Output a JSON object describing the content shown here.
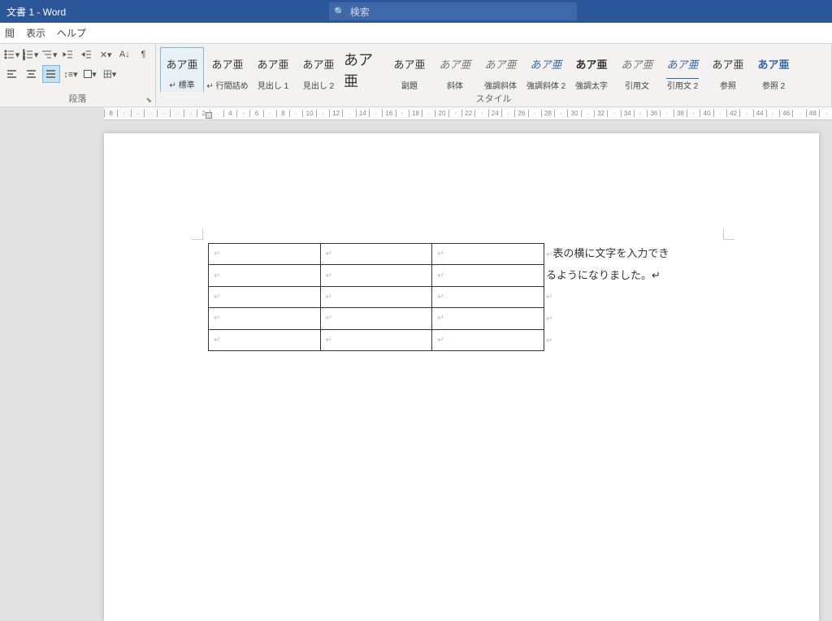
{
  "titlebar": {
    "title": "文書 1  -  Word",
    "search_placeholder": "検索"
  },
  "menubar": {
    "tabs": [
      "閲",
      "表示",
      "ヘルプ"
    ]
  },
  "ribbon": {
    "paragraph_label": "段落",
    "styles_label": "スタイル",
    "styles": [
      {
        "preview": "あア亜",
        "name": "↵ 標準",
        "cls": ""
      },
      {
        "preview": "あア亜",
        "name": "↵ 行間詰め",
        "cls": ""
      },
      {
        "preview": "あア亜",
        "name": "見出し 1",
        "cls": ""
      },
      {
        "preview": "あア亜",
        "name": "見出し 2",
        "cls": ""
      },
      {
        "preview": "あア亜",
        "name": "表題",
        "cls": "head"
      },
      {
        "preview": "あア亜",
        "name": "副題",
        "cls": ""
      },
      {
        "preview": "あア亜",
        "name": "斜体",
        "cls": "italic"
      },
      {
        "preview": "あア亜",
        "name": "強調斜体",
        "cls": "italic"
      },
      {
        "preview": "あア亜",
        "name": "強調斜体 2",
        "cls": "italic blue"
      },
      {
        "preview": "あア亜",
        "name": "強調太字",
        "cls": "bold"
      },
      {
        "preview": "あア亜",
        "name": "引用文",
        "cls": "italic"
      },
      {
        "preview": "あア亜",
        "name": "引用文 2",
        "cls": "italic blue"
      },
      {
        "preview": "あア亜",
        "name": "参照",
        "cls": ""
      },
      {
        "preview": "あア亜",
        "name": "参照 2",
        "cls": "bold blue"
      }
    ]
  },
  "document": {
    "side_lines": [
      "表の横に文字を入力でき",
      "るようになりました。↵",
      "↵",
      "↵",
      "↵"
    ],
    "table": {
      "rows": 5,
      "cols": 3,
      "cell_mark": "↵"
    }
  },
  "ruler": {
    "left": [
      8
    ],
    "marks": [
      2,
      4,
      6,
      8,
      10,
      12,
      14,
      16,
      18,
      20,
      22,
      24,
      26,
      28,
      30,
      32,
      34,
      36,
      38,
      40,
      42,
      44,
      46,
      48
    ]
  }
}
